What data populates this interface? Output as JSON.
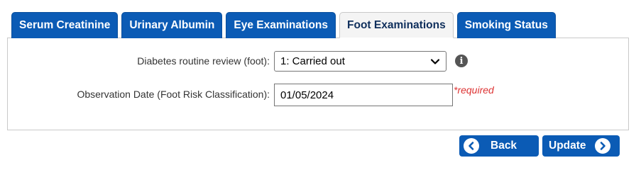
{
  "tabs": [
    {
      "label": "Serum Creatinine"
    },
    {
      "label": "Urinary Albumin"
    },
    {
      "label": "Eye Examinations"
    },
    {
      "label": "Foot Examinations",
      "active": true
    },
    {
      "label": "Smoking Status"
    }
  ],
  "form": {
    "review_label": "Diabetes routine review (foot):",
    "review_value": "1: Carried out",
    "info_icon": "info-icon",
    "date_label": "Observation Date (Foot Risk Classification):",
    "date_value": "01/05/2024",
    "required_text": "*required"
  },
  "buttons": {
    "back_label": "Back",
    "update_label": "Update"
  },
  "colors": {
    "tab_blue": "#0b5bb5",
    "required_red": "#dd3333"
  }
}
